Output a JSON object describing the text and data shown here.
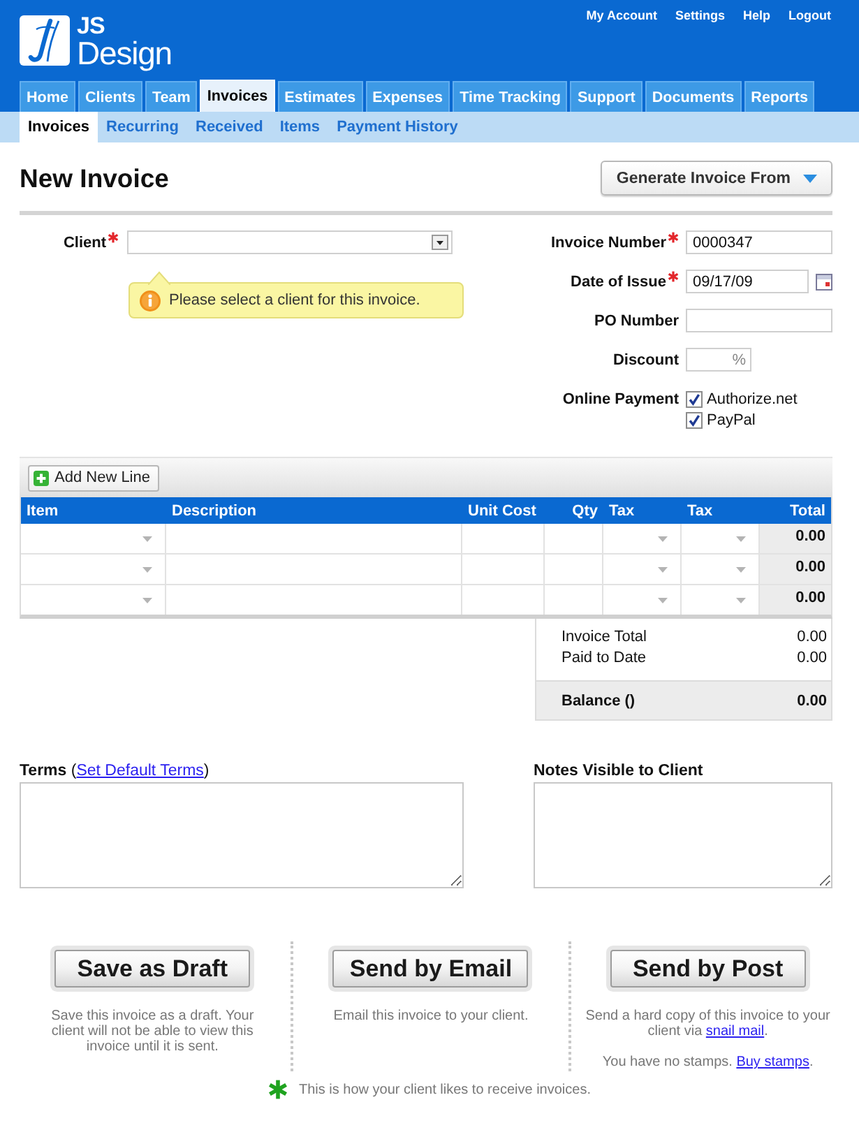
{
  "header": {
    "logo": {
      "line_1": "JS",
      "line_2": "Design"
    },
    "top_links": [
      "My Account",
      "Settings",
      "Help",
      "Logout"
    ]
  },
  "main_tabs": [
    {
      "label": "Home",
      "selected": false
    },
    {
      "label": "Clients",
      "selected": false
    },
    {
      "label": "Team",
      "selected": false
    },
    {
      "label": "Invoices",
      "selected": true
    },
    {
      "label": "Estimates",
      "selected": false
    },
    {
      "label": "Expenses",
      "selected": false
    },
    {
      "label": "Time Tracking",
      "selected": false
    },
    {
      "label": "Support",
      "selected": false
    },
    {
      "label": "Documents",
      "selected": false
    },
    {
      "label": "Reports",
      "selected": false
    }
  ],
  "sub_tabs": [
    {
      "label": "Invoices",
      "selected": true
    },
    {
      "label": "Recurring",
      "selected": false
    },
    {
      "label": "Received",
      "selected": false
    },
    {
      "label": "Items",
      "selected": false
    },
    {
      "label": "Payment History",
      "selected": false
    }
  ],
  "page_title": "New Invoice",
  "generate_button": "Generate Invoice From",
  "client": {
    "label": "Client",
    "required": true,
    "hint": "Please select a client for this invoice."
  },
  "invoice_fields": [
    {
      "kind": "text",
      "label": "Invoice Number",
      "required": true,
      "value": "0000347"
    },
    {
      "kind": "date",
      "label": "Date of Issue",
      "required": true,
      "value": "09/17/09"
    },
    {
      "kind": "text",
      "label": "PO Number",
      "required": false
    },
    {
      "kind": "percent",
      "label": "Discount",
      "required": false,
      "suffix": "%"
    },
    {
      "kind": "checks",
      "label": "Online Payment",
      "required": false,
      "options": [
        {
          "label": "Authorize.net",
          "checked": true
        },
        {
          "label": "PayPal",
          "checked": true
        }
      ]
    }
  ],
  "line_items": {
    "add_button": "Add New Line",
    "columns": [
      {
        "label": "Item",
        "kind": "select"
      },
      {
        "label": "Description",
        "kind": "text"
      },
      {
        "label": "Unit Cost",
        "kind": "text"
      },
      {
        "label": "Qty",
        "kind": "text"
      },
      {
        "label": "Tax",
        "kind": "select"
      },
      {
        "label": "Tax",
        "kind": "select"
      },
      {
        "label": "Total",
        "kind": "total"
      }
    ],
    "rows": [
      {
        "total": "0.00"
      },
      {
        "total": "0.00"
      },
      {
        "total": "0.00"
      }
    ]
  },
  "totals": [
    {
      "label": "Invoice Total",
      "value": "0.00"
    },
    {
      "label": "Paid to Date",
      "value": "0.00"
    }
  ],
  "balance": {
    "label": "Balance ()",
    "value": "0.00"
  },
  "terms": {
    "label": "Terms",
    "link_open": "(",
    "link": "Set Default Terms",
    "link_close": ")"
  },
  "notes": {
    "label": "Notes Visible to Client"
  },
  "actions": [
    {
      "button": "Save as Draft",
      "paragraphs": [
        [
          {
            "kind": "text",
            "text": "Save this invoice as a draft. Your client will not be able to view this invoice until it is sent."
          }
        ]
      ]
    },
    {
      "button": "Send by Email",
      "paragraphs": [
        [
          {
            "kind": "text",
            "text": "Email this invoice to your client."
          }
        ]
      ]
    },
    {
      "button": "Send by Post",
      "paragraphs": [
        [
          {
            "kind": "text",
            "text": "Send a hard copy of this invoice to your client via "
          },
          {
            "kind": "link",
            "text": "snail mail"
          },
          {
            "kind": "text",
            "text": "."
          }
        ],
        [
          {
            "kind": "text",
            "text": "You have no stamps. "
          },
          {
            "kind": "link",
            "text": "Buy stamps"
          },
          {
            "kind": "text",
            "text": "."
          }
        ]
      ]
    }
  ],
  "footer_note": "This is how your client likes to receive invoices."
}
